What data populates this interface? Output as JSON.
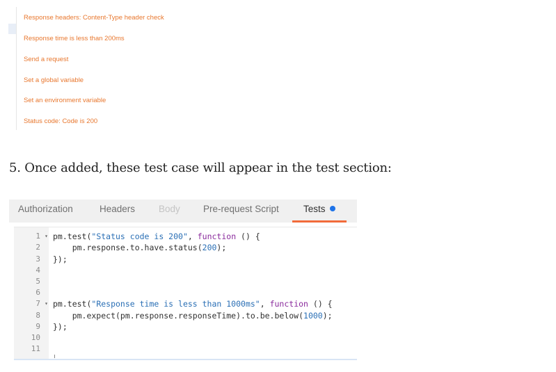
{
  "snippets": {
    "items": [
      "Response headers: Content-Type header check",
      "Response time is less than 200ms",
      "Send a request",
      "Set a global variable",
      "Set an environment variable",
      "Status code: Code is 200"
    ]
  },
  "step": {
    "text": "5. Once added, these test case will appear in the test section:"
  },
  "tabs": [
    {
      "label": "Authorization",
      "state": "normal"
    },
    {
      "label": "Headers",
      "state": "normal"
    },
    {
      "label": "Body",
      "state": "disabled"
    },
    {
      "label": "Pre-request Script",
      "state": "normal"
    },
    {
      "label": "Tests",
      "state": "active"
    }
  ],
  "editor": {
    "line_numbers": [
      "1",
      "2",
      "3",
      "4",
      "5",
      "6",
      "7",
      "8",
      "9",
      "10",
      "11"
    ],
    "fold_markers": [
      "▾",
      "▾"
    ],
    "code": {
      "l1_pre": "pm.test(",
      "l1_str": "\"Status code is 200\"",
      "l1_mid": ", ",
      "l1_kw": "function",
      "l1_post": " () {",
      "l2_pre": "    pm.response.to.have.status(",
      "l2_num": "200",
      "l2_post": ");",
      "l3": "});",
      "l7_pre": "pm.test(",
      "l7_str": "\"Response time is less than 1000ms\"",
      "l7_mid": ", ",
      "l7_kw": "function",
      "l7_post": " () {",
      "l8_pre": "    pm.expect(pm.response.responseTime).to.be.below(",
      "l8_num": "1000",
      "l8_post": ");",
      "l9": "});"
    }
  },
  "colors": {
    "snippet_text": "#e8772e",
    "active_tab_underline": "#f26b3a",
    "tests_dot": "#1e73e8",
    "code_string": "#2a6fb5",
    "code_keyword": "#8a2a9c"
  },
  "icons": {
    "fold_marker": "chevron-down-icon",
    "tests_indicator": "dot-icon"
  }
}
